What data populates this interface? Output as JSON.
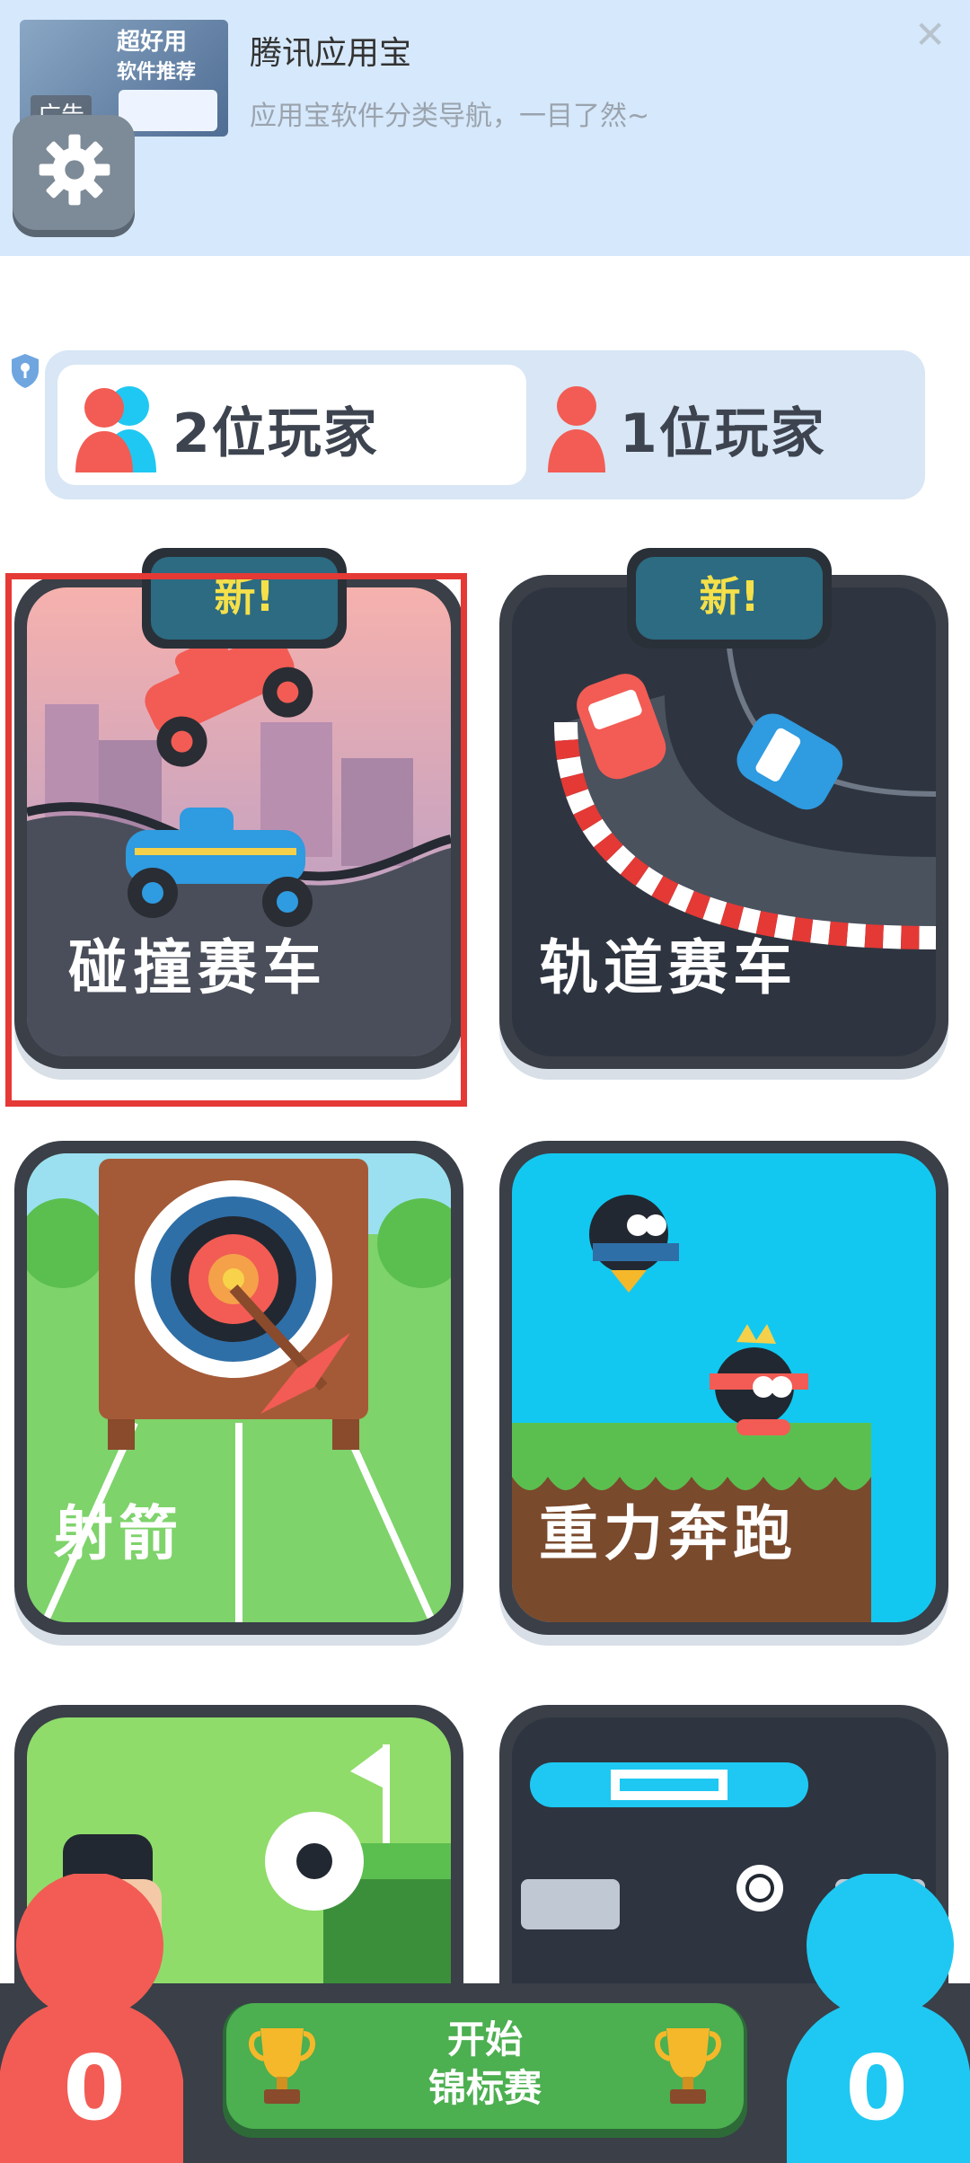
{
  "ad": {
    "thumb_line1": "超好用",
    "thumb_line2": "软件推荐",
    "label": "广告",
    "title": "腾讯应用宝",
    "subtitle": "应用宝软件分类导航，一目了然~",
    "close": "✕"
  },
  "player_toggle": {
    "two_players": "2位玩家",
    "one_player": "1位玩家",
    "selected": "2位玩家"
  },
  "games": [
    {
      "title": "碰撞赛车",
      "badge": "新!"
    },
    {
      "title": "轨道赛车",
      "badge": "新!"
    },
    {
      "title": "射箭",
      "badge": ""
    },
    {
      "title": "重力奔跑",
      "badge": ""
    },
    {
      "title": "",
      "badge": ""
    },
    {
      "title": "",
      "badge": ""
    }
  ],
  "scores": {
    "red": "0",
    "blue": "0"
  },
  "tournament": {
    "line1": "开始",
    "line2": "锦标赛"
  },
  "colors": {
    "red_player": "#f25c54",
    "blue_player": "#1fc8f2",
    "accent_green": "#4caf50",
    "badge_text": "#f5e04a"
  }
}
